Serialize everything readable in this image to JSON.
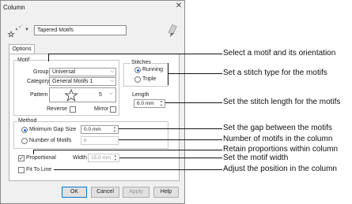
{
  "dialog": {
    "title": "Column",
    "motif_name": "Tapered Motifs",
    "tab": "Options"
  },
  "motif": {
    "legend": "Motif",
    "group_label": "Group",
    "group_value": "Universal",
    "category_label": "Category",
    "category_value": "General Motifs 1",
    "pattern_label": "Pattern",
    "pattern_value": "5",
    "reverse_label": "Reverse",
    "mirror_label": "Mirror"
  },
  "stitches": {
    "legend": "Stitches",
    "running_label": "Running",
    "triple_label": "Triple",
    "length_label": "Length",
    "length_value": "6.0 mm"
  },
  "method": {
    "legend": "Method",
    "min_gap_label": "Minimum Gap Size",
    "min_gap_value": "0.0 mm",
    "num_motifs_label": "Number of Motifs",
    "num_motifs_value": "6"
  },
  "proportional": {
    "label": "Proportional",
    "width_label": "Width",
    "width_value": "15.0 mm"
  },
  "fit_label": "Fit To Line",
  "buttons": {
    "ok": "OK",
    "cancel": "Cancel",
    "apply": "Apply",
    "help": "Help"
  },
  "callouts": [
    "Select a motif and its orientation",
    "Set a stitch type for the motifs",
    "Set the stitch length for the motifs",
    "Set the gap between the motifs",
    "Number of motifs in the column",
    "Retain proportions within column",
    "Set the motif width",
    "Adjust the position in the column"
  ]
}
